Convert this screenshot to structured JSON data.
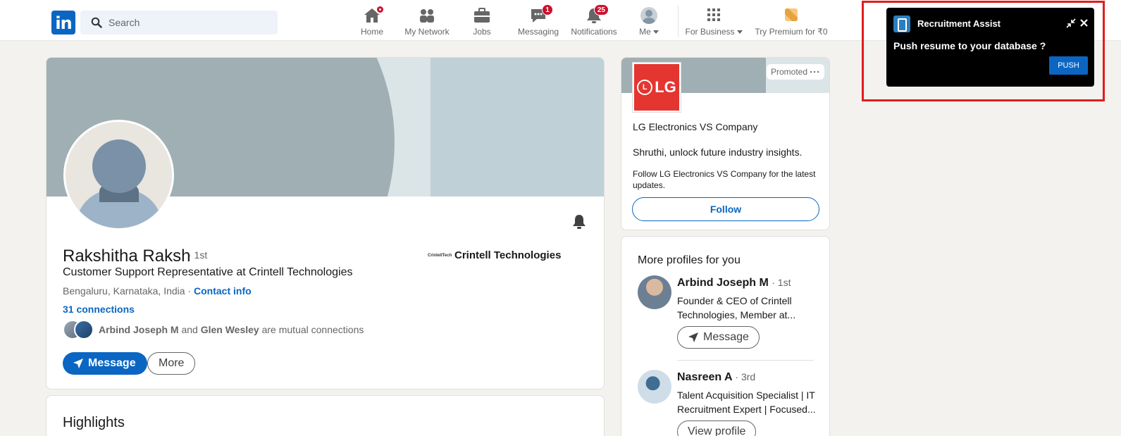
{
  "nav": {
    "search_placeholder": "Search",
    "items": [
      {
        "label": "Home"
      },
      {
        "label": "My Network"
      },
      {
        "label": "Jobs"
      },
      {
        "label": "Messaging",
        "badge": "1"
      },
      {
        "label": "Notifications",
        "badge": "25"
      },
      {
        "label": "Me"
      },
      {
        "label": "For Business"
      },
      {
        "label": "Try Premium for ₹0"
      }
    ]
  },
  "profile": {
    "name": "Rakshitha Raksh",
    "degree": "· 1st",
    "headline": "Customer Support Representative at Crintell Technologies",
    "location": "Bengaluru, Karnataka, India ·",
    "contact_info": "Contact info",
    "connections": "31 connections",
    "mutual_a": "Arbind Joseph M",
    "mutual_and": "and",
    "mutual_b": "Glen Wesley",
    "mutual_suffix": "are mutual connections",
    "company_logo_text": "CrintellTech",
    "company": "Crintell Technologies",
    "message_label": "Message",
    "more_label": "More"
  },
  "highlights": {
    "title": "Highlights"
  },
  "ad": {
    "promoted": "Promoted",
    "logo_text": "LG",
    "title": "LG Electronics VS Company",
    "desc": "Shruthi, unlock future industry insights.",
    "small": "Follow LG Electronics VS Company for the latest updates.",
    "follow_label": "Follow"
  },
  "more_profiles": {
    "title": "More profiles for you",
    "people": [
      {
        "name": "Arbind Joseph M",
        "degree": "· 1st",
        "headline": "Founder & CEO of Crintell Technologies, Member at...",
        "button": "Message"
      },
      {
        "name": "Nasreen A",
        "degree": "· 3rd",
        "headline": "Talent Acquisition Specialist | IT Recruitment Expert | Focused...",
        "button": "View profile"
      }
    ]
  },
  "recruitment_assist": {
    "title": "Recruitment Assist",
    "question": "Push resume to your database ?",
    "push_label": "PUSH"
  },
  "colors": {
    "brand": "#0a66c2",
    "badge": "#cb112d",
    "highlight": "#e21d1d",
    "lg_red": "#e53531"
  }
}
